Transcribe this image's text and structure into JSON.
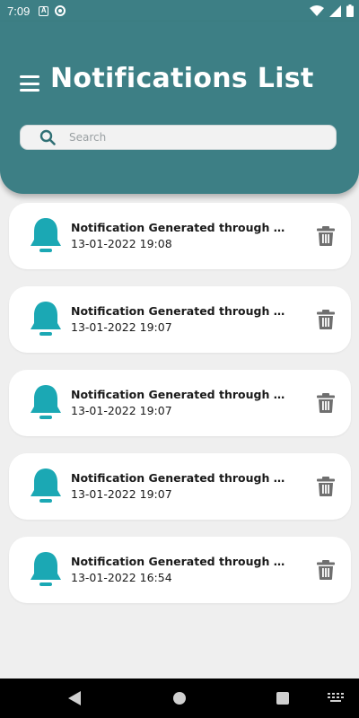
{
  "status_bar": {
    "time": "7:09",
    "a_label": "A"
  },
  "header": {
    "title": "Notifications List"
  },
  "search": {
    "placeholder": "Search"
  },
  "notifications": [
    {
      "title": "Notification Generated through Devic…",
      "time": "13-01-2022 19:08"
    },
    {
      "title": "Notification Generated through Devic…",
      "time": "13-01-2022 19:07"
    },
    {
      "title": "Notification Generated through Devic…",
      "time": "13-01-2022 19:07"
    },
    {
      "title": "Notification Generated through Devic…",
      "time": "13-01-2022 19:07"
    },
    {
      "title": "Notification Generated through Devic…",
      "time": "13-01-2022 16:54"
    }
  ],
  "icons": {
    "menu": "menu-icon",
    "search": "search-icon",
    "bell": "bell-icon",
    "trash": "trash-icon"
  },
  "colors": {
    "header": "#3d7f85",
    "bell": "#1ba8b4",
    "trash": "#6f6f6f",
    "background": "#efefef"
  }
}
